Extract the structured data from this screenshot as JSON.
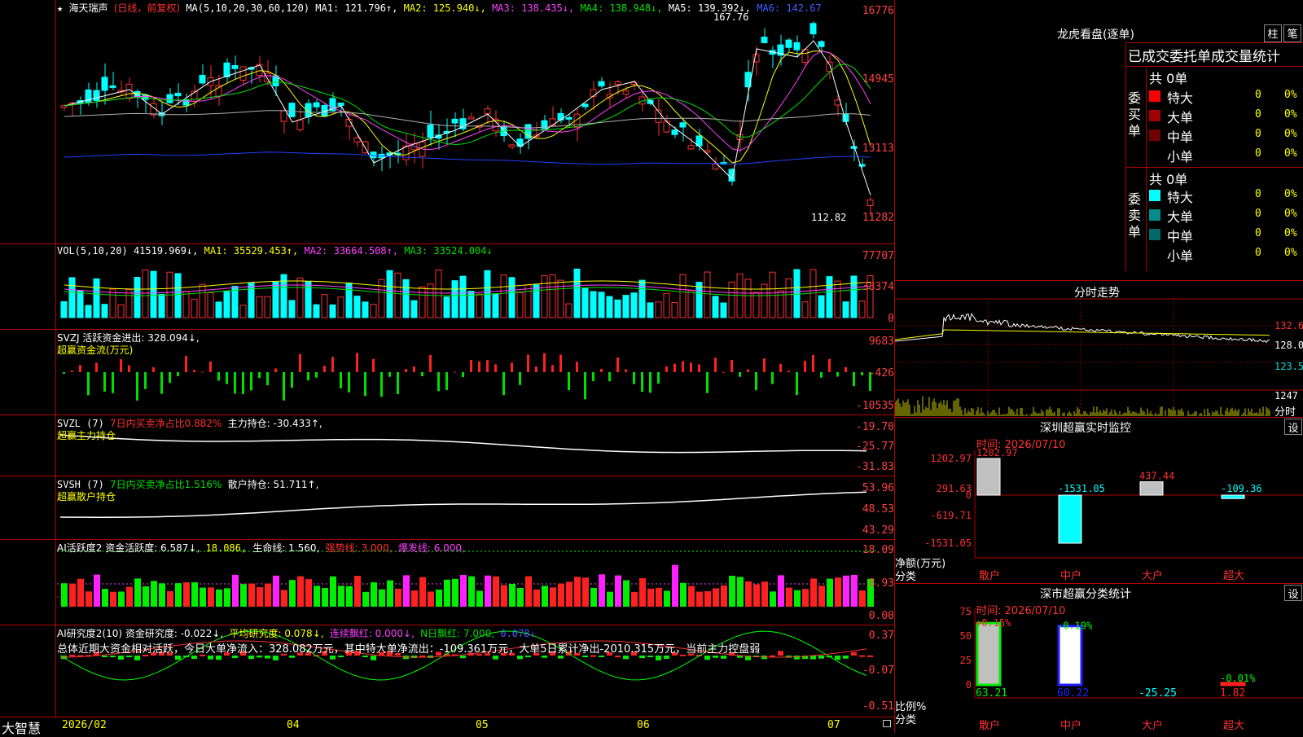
{
  "main": {
    "star": "★",
    "stock_name": "海天瑞声",
    "period": "(日线，前复权)",
    "ma_legend": "MA(5,10,20,30,60,120)",
    "ma1": "MA1: 121.796↑,",
    "ma2": "MA2: 125.940↓,",
    "ma3": "MA3: 138.435↓,",
    "ma4": "MA4: 138.948↓,",
    "ma5": "MA5: 139.392↓,",
    "ma6": "MA6: 142.67",
    "high_label": "167.76",
    "low_label": "112.82",
    "y_labels": [
      "16776",
      "14945",
      "13113",
      "11282"
    ]
  },
  "vol": {
    "legend": "VOL(5,10,20)",
    "v": "41519.969↓,",
    "ma1": "MA1: 35529.453↑,",
    "ma2": "MA2: 33664.508↑,",
    "ma3": "MA3: 33524.004↓",
    "y_labels": [
      "77707",
      "38374",
      "0"
    ]
  },
  "svzj": {
    "legend": "SVZJ  活跃资金进出: 328.094↓,",
    "sub": "超赢资金流(万元)",
    "y_labels": [
      "9683",
      "-426",
      "-10535"
    ]
  },
  "svzl": {
    "legend_a": "SVZL (7)",
    "legend_b": "7日内买卖净占比0.882%",
    "legend_c": "主力持仓: -30.433↑,",
    "sub": "超赢主力持仓",
    "y_labels": [
      "-19.70",
      "-25.77",
      "-31.83"
    ]
  },
  "svsh": {
    "legend_a": "SVSH (7)",
    "legend_b": "7日内买卖净占比1.516%",
    "legend_c": "散户持仓: 51.711↑,",
    "sub": "超赢散户持仓",
    "y_labels": [
      "53.96",
      "48.53",
      "43.29"
    ]
  },
  "ai1": {
    "a": "AI活跃度2 资金活跃度: 6.587↓,",
    "b": "18.086,",
    "c": "生命线: 1.560,",
    "d": "强势线: 3.000,",
    "e": "爆发线: 6.000,",
    "y_labels": [
      "18.09",
      "8.93",
      "0.00"
    ]
  },
  "ai2": {
    "a": "AI研究度2(10) 资金研究度: -0.022↓,",
    "b": "平均研究度: 0.078↓,",
    "c": "连续飘红: 0.000↓,",
    "d": "N日飘红: 7.000,",
    "e": "0.078↓",
    "summary": "总体近期大资金相对活跃，今日大单净流入：328.082万元，其中特大单净流出：-109.361万元，大单5日累计净出-2010.315万元，当前主力控盘弱",
    "y_labels": [
      "0.37",
      "-0.07",
      "-0.51"
    ]
  },
  "bottom": {
    "brand": "大智慧",
    "dates": [
      "2026/02",
      "04",
      "05",
      "06",
      "07"
    ]
  },
  "right": {
    "lhb_title": "龙虎看盘(逐单)",
    "btn_zhu": "柱",
    "btn_bi": "笔",
    "header": "已成交委托单成交量统计",
    "buy_label": "委买单",
    "sell_label": "委卖单",
    "buy_total": "共 0单",
    "sell_total": "共 0单",
    "buy_rows": [
      {
        "name": "特大",
        "count": "0",
        "pct": "0%",
        "color": "#ff0000"
      },
      {
        "name": "大单",
        "count": "0",
        "pct": "0%",
        "color": "#a00000"
      },
      {
        "name": "中单",
        "count": "0",
        "pct": "0%",
        "color": "#700000"
      },
      {
        "name": "小单",
        "count": "0",
        "pct": "0%",
        "color": "#000000"
      }
    ],
    "sell_rows": [
      {
        "name": "特大",
        "count": "0",
        "pct": "0%",
        "color": "#00ffff"
      },
      {
        "name": "大单",
        "count": "0",
        "pct": "0%",
        "color": "#008c8c"
      },
      {
        "name": "中单",
        "count": "0",
        "pct": "0%",
        "color": "#006a6a"
      },
      {
        "name": "小单",
        "count": "0",
        "pct": "0%",
        "color": "#000000"
      }
    ],
    "fs_title": "分时走势",
    "fs_y": [
      "132.6",
      "128.0",
      "123.5"
    ],
    "fs_vol": "1247",
    "fs_vol_label": "分时",
    "mon_title": "深圳超赢实时监控",
    "mon_time": "时间: 2026/07/10",
    "mon_set": "设",
    "mon_y": [
      "1202.97",
      "291.63",
      "0",
      "-619.71",
      "-1531.05"
    ],
    "mon_bars": [
      {
        "cat": "散户",
        "value": 1202.97,
        "label": "1202.97"
      },
      {
        "cat": "中户",
        "value": -1531.05,
        "label": "-1531.05"
      },
      {
        "cat": "大户",
        "value": 437.44,
        "label": "437.44"
      },
      {
        "cat": "超大",
        "value": -109.36,
        "label": "-109.36"
      }
    ],
    "mon_axis1": "净额(万元)",
    "mon_axis2": "分类",
    "cls_title": "深市超赢分类统计",
    "cls_time": "时间: 2026/07/10",
    "cls_set": "设",
    "cls_y": [
      "75",
      "50",
      "25",
      "0"
    ],
    "cls_bars": [
      {
        "cat": "散户",
        "value": 63.21,
        "top": "+0.15%",
        "bottom": "63.21"
      },
      {
        "cat": "中户",
        "value": 60.22,
        "top": "-0.19%",
        "bottom": "60.22"
      },
      {
        "cat": "大户",
        "value": -25.25,
        "top": "",
        "bottom": "-25.25"
      },
      {
        "cat": "超大",
        "value": 1.82,
        "top": "-0.01%",
        "bottom": "1.82"
      }
    ],
    "cls_axis1": "比例%",
    "cls_axis2": "分类"
  }
}
